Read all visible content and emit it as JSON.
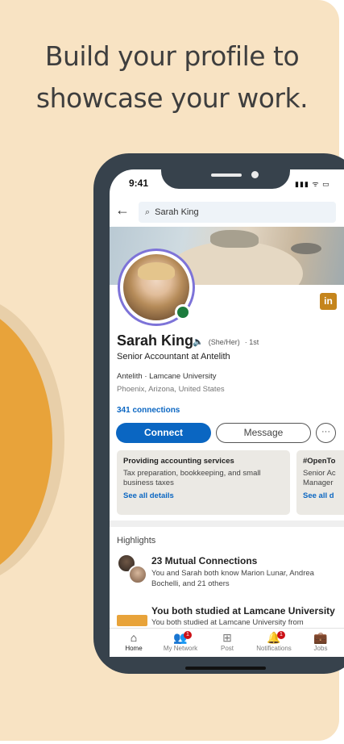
{
  "promo": {
    "headline_line1": "Build your profile to",
    "headline_line2": "showcase your work."
  },
  "status_bar": {
    "time": "9:41",
    "icons": "▮▮▮ ᯤ ▭"
  },
  "search": {
    "back_icon": "←",
    "icon": "⌕",
    "value": "Sarah King"
  },
  "profile": {
    "name": "Sarah King",
    "speaker_icon": "🔈",
    "pronouns": "(She/Her)",
    "degree": "· 1st",
    "headline": "Senior Accountant at Antelith",
    "company": "Antelith · Lamcane University",
    "location": "Phoenix, Arizona, United States",
    "connections": "341 connections",
    "badge": "in"
  },
  "actions": {
    "connect": "Connect",
    "message": "Message",
    "more": "···"
  },
  "services": [
    {
      "title": "Providing accounting services",
      "desc_line1": "Tax preparation, bookkeeping, and small",
      "desc_line2": "business taxes",
      "link": "See all details"
    },
    {
      "title": "#OpenTo",
      "desc_line1": "Senior Ac",
      "desc_line2": "Manager",
      "link": "See all d"
    }
  ],
  "highlights": {
    "title": "Highlights",
    "mutual_title": "23 Mutual Connections",
    "mutual_desc": "You and Sarah both know Marion Lunar, Andrea Bochelli, and 21 others",
    "edu_title": "You both studied at Lamcane University",
    "edu_desc": "You both studied at Lamcane University from"
  },
  "nav": [
    {
      "label": "Home",
      "icon": "⌂",
      "badge": ""
    },
    {
      "label": "My Network",
      "icon": "👥",
      "badge": "1"
    },
    {
      "label": "Post",
      "icon": "⊞",
      "badge": ""
    },
    {
      "label": "Notifications",
      "icon": "🔔",
      "badge": "1"
    },
    {
      "label": "Jobs",
      "icon": "💼",
      "badge": ""
    }
  ]
}
